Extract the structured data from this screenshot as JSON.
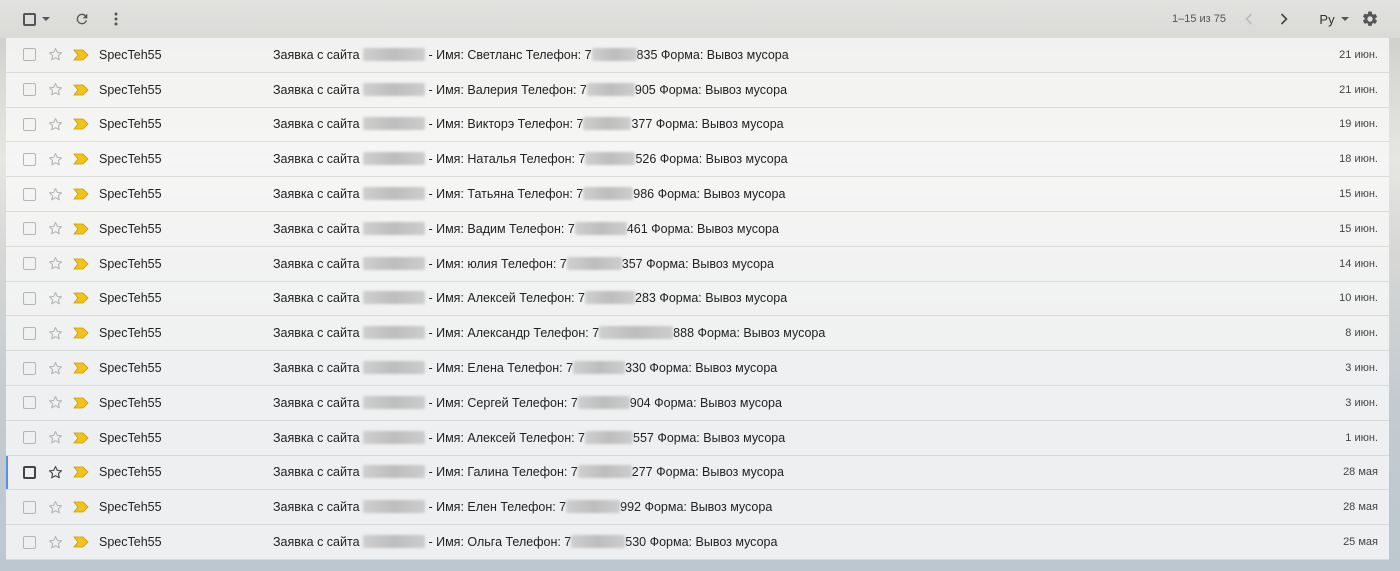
{
  "toolbar": {
    "pager": "1–15 из 75",
    "lang": "Ру"
  },
  "emails": [
    {
      "sender": "SpecTeh55",
      "pre": "Заявка с сайта ",
      "mid": " - Имя: Светланс Телефон: 7",
      "post": "835 Форма: Вывоз мусора",
      "date": "21 июн."
    },
    {
      "sender": "SpecTeh55",
      "pre": "Заявка с сайта ",
      "mid": " - Имя: Валерия Телефон: 7",
      "post": "905 Форма: Вывоз мусора",
      "date": "21 июн."
    },
    {
      "sender": "SpecTeh55",
      "pre": "Заявка с сайта ",
      "mid": " - Имя: Викторэ Телефон: 7",
      "post": "377 Форма: Вывоз мусора",
      "date": "19 июн."
    },
    {
      "sender": "SpecTeh55",
      "pre": "Заявка с сайта ",
      "mid": " - Имя: Наталья Телефон: 7",
      "post": "526 Форма: Вывоз мусора",
      "date": "18 июн."
    },
    {
      "sender": "SpecTeh55",
      "pre": "Заявка с сайта ",
      "mid": " - Имя: Татьяна Телефон: 7",
      "post": "986 Форма: Вывоз мусора",
      "date": "15 июн."
    },
    {
      "sender": "SpecTeh55",
      "pre": "Заявка с сайта ",
      "mid": " - Имя: Вадим Телефон: 7",
      "post": "461 Форма: Вывоз мусора",
      "date": "15 июн."
    },
    {
      "sender": "SpecTeh55",
      "pre": "Заявка с сайта ",
      "mid": " - Имя: юлия Телефон: 7",
      "post": "357 Форма: Вывоз мусора",
      "date": "14 июн."
    },
    {
      "sender": "SpecTeh55",
      "pre": "Заявка с сайта ",
      "mid": " - Имя: Алексей Телефон: 7",
      "post": "283 Форма: Вывоз мусора",
      "date": "10 июн."
    },
    {
      "sender": "SpecTeh55",
      "pre": "Заявка с сайта ",
      "mid": " - Имя: Александр Телефон: 7",
      "post": "888 Форма: Вывоз мусора",
      "date": "8 июн."
    },
    {
      "sender": "SpecTeh55",
      "pre": "Заявка с сайта ",
      "mid": " - Имя: Елена Телефон: 7",
      "post": "330 Форма: Вывоз мусора",
      "date": "3 июн."
    },
    {
      "sender": "SpecTeh55",
      "pre": "Заявка с сайта ",
      "mid": " - Имя: Сергей Телефон: 7",
      "post": "904 Форма: Вывоз мусора",
      "date": "3 июн."
    },
    {
      "sender": "SpecTeh55",
      "pre": "Заявка с сайта ",
      "mid": " - Имя: Алексей Телефон: 7",
      "post": "557 Форма: Вывоз мусора",
      "date": "1 июн."
    },
    {
      "sender": "SpecTeh55",
      "pre": "Заявка с сайта ",
      "mid": " - Имя: Галина Телефон: 7",
      "post": "277 Форма: Вывоз мусора",
      "date": "28 мая"
    },
    {
      "sender": "SpecTeh55",
      "pre": "Заявка с сайта ",
      "mid": " - Имя: Елен Телефон: 7",
      "post": "992 Форма: Вывоз мусора",
      "date": "28 мая"
    },
    {
      "sender": "SpecTeh55",
      "pre": "Заявка с сайта ",
      "mid": " - Имя: Ольга Телефон: 7",
      "post": "530 Форма: Вывоз мусора",
      "date": "25 мая"
    }
  ],
  "colors": {
    "important_marker": "#f2c31a",
    "accent": "#4d90fe"
  },
  "icons": [
    "select-all-checkbox-icon",
    "refresh-icon",
    "more-vert-icon",
    "chevron-left-icon",
    "chevron-right-icon",
    "gear-icon",
    "star-icon",
    "important-marker-icon"
  ]
}
